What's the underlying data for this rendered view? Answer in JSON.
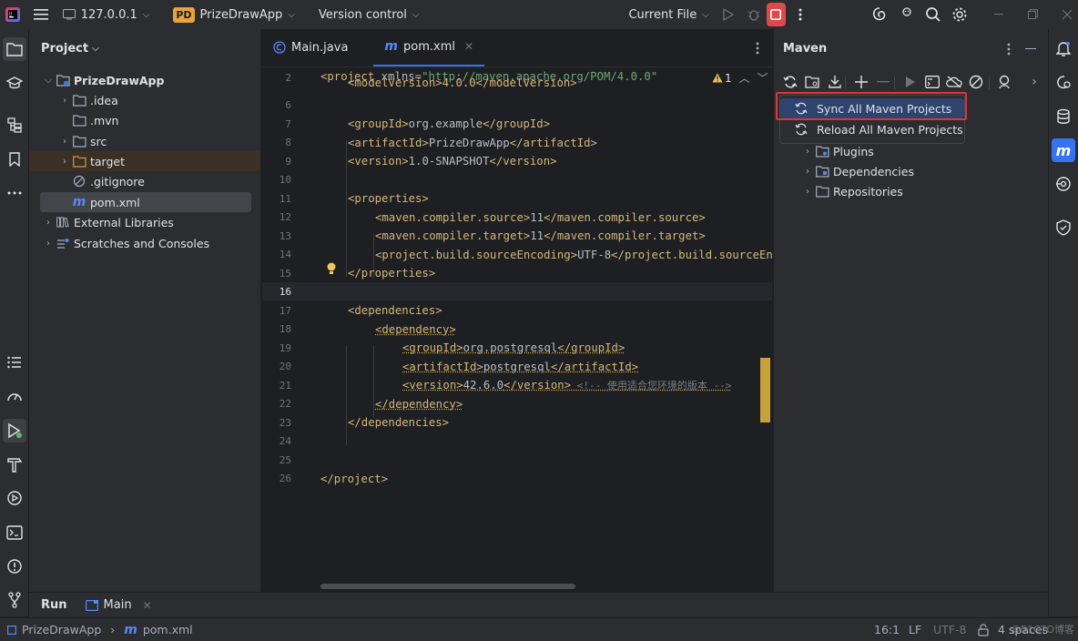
{
  "titlebar": {
    "host": "127.0.0.1",
    "project_badge": "PD",
    "project_name": "PrizeDrawApp",
    "vcs": "Version control",
    "run_config": "Current File"
  },
  "project_panel": {
    "title": "Project",
    "tree": [
      {
        "label": "PrizeDrawApp"
      },
      {
        "label": ".idea"
      },
      {
        "label": ".mvn"
      },
      {
        "label": "src"
      },
      {
        "label": "target"
      },
      {
        "label": ".gitignore"
      },
      {
        "label": "pom.xml"
      },
      {
        "label": "External Libraries"
      },
      {
        "label": "Scratches and Consoles"
      }
    ]
  },
  "editor": {
    "tabs": [
      {
        "label": "Main.java"
      },
      {
        "label": "pom.xml"
      }
    ],
    "warnings": "1",
    "line_numbers": [
      "2",
      "6",
      "7",
      "8",
      "9",
      "10",
      "11",
      "12",
      "13",
      "14",
      "15",
      "16",
      "17",
      "18",
      "19",
      "20",
      "21",
      "22",
      "23",
      "24",
      "25",
      "26"
    ],
    "code": {
      "l2_tag": "<project ",
      "l2_attr": "xmlns=",
      "l2_str": "\"http://maven.apache.org/POM/4.0.0\"",
      "l2b": "<modelVersion>4.0.0</modelVersion>",
      "l7a": "<groupId>",
      "l7b": "org.example",
      "l7c": "</groupId>",
      "l8a": "<artifactId>",
      "l8b": "PrizeDrawApp",
      "l8c": "</artifactId>",
      "l9a": "<version>",
      "l9b": "1.0-SNAPSHOT",
      "l9c": "</version>",
      "l11": "<properties>",
      "l12a": "<maven.compiler.source>",
      "l12b": "11",
      "l12c": "</maven.compiler.source>",
      "l13a": "<maven.compiler.target>",
      "l13b": "11",
      "l13c": "</maven.compiler.target>",
      "l14a": "<project.build.sourceEncoding>",
      "l14b": "UTF-8",
      "l14c": "</project.build.sourceEn",
      "l15": "</properties>",
      "l17": "<dependencies>",
      "l18": "<dependency>",
      "l19a": "<groupId>",
      "l19b": "org.postgresql",
      "l19c": "</groupId>",
      "l20a": "<artifactId>",
      "l20b": "postgresql",
      "l20c": "</artifactId>",
      "l21a": "<version>",
      "l21b": "42.6.0",
      "l21c": "</version>",
      "l21d": " <!-- 使用适合您环境的版本 -->",
      "l22": "</dependency>",
      "l23": "</dependencies>",
      "l26": "</project>"
    }
  },
  "maven_panel": {
    "title": "Maven",
    "menu": [
      {
        "label": "Sync All Maven Projects"
      },
      {
        "label": "Reload All Maven Projects"
      }
    ],
    "tree": [
      {
        "label": "Plugins"
      },
      {
        "label": "Dependencies"
      },
      {
        "label": "Repositories"
      }
    ]
  },
  "run_bar": {
    "title": "Run",
    "tab": "Main"
  },
  "status_bar": {
    "crumb_project": "PrizeDrawApp",
    "crumb_file": "pom.xml",
    "position": "16:1",
    "line_sep": "LF",
    "encoding": "UTF-8",
    "indent": "4 spaces",
    "watermark": "@51CTO博客"
  },
  "colors": {
    "accent": "#3574f0",
    "stop_button": "#e0494b",
    "highlight_box": "#e0333a",
    "menu_selection": "#2e436e"
  }
}
